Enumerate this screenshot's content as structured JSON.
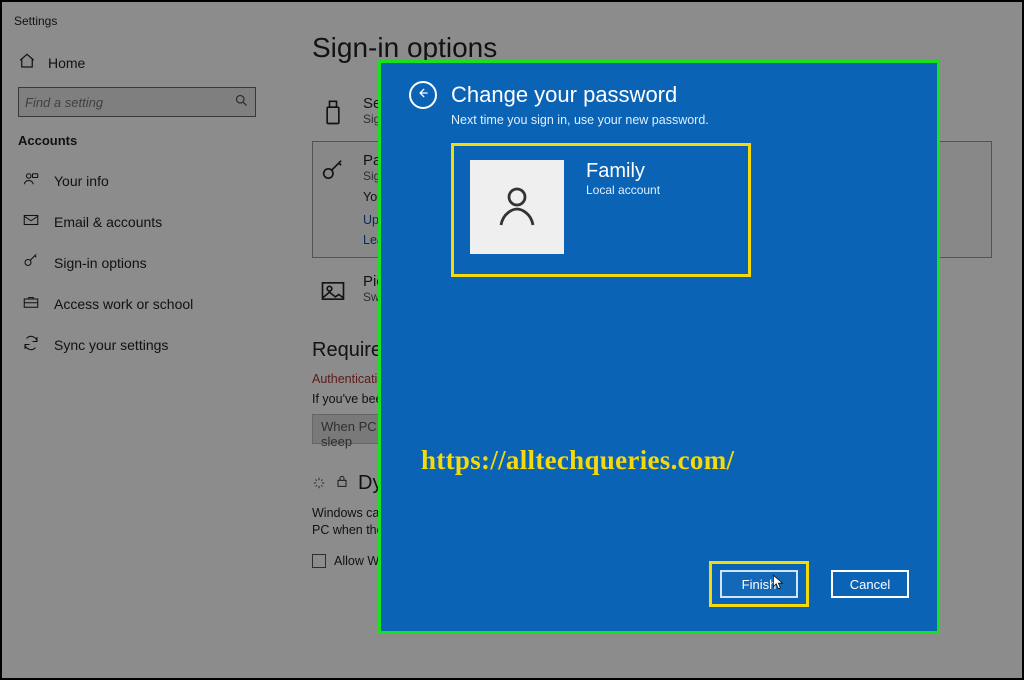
{
  "window_title": "Settings",
  "sidebar": {
    "home": "Home",
    "search_placeholder": "Find a setting",
    "section": "Accounts",
    "items": [
      {
        "label": "Your info"
      },
      {
        "label": "Email & accounts"
      },
      {
        "label": "Sign-in options"
      },
      {
        "label": "Access work or school"
      },
      {
        "label": "Sync your settings"
      }
    ]
  },
  "main": {
    "title": "Sign-in options",
    "options": {
      "security_key": {
        "title": "Security Key",
        "sub": "Sign in with a physical security key"
      },
      "password": {
        "title": "Password",
        "sub": "Sign in with your account's password",
        "body": "Your account password is used to sign in to Windows, apps, and services.",
        "link1": "Update your security questions",
        "link2": "Learn more"
      },
      "picture": {
        "title": "Picture Password",
        "sub": "Swipe and tap your favorite photo to unlock your device"
      }
    },
    "require": {
      "heading": "Require sign-in",
      "auth_warning": "Authentication is required when this device wakes from sleep.",
      "body": "If you've been away, when should Windows require you to sign in again?",
      "select_value": "When PC wakes up from sleep"
    },
    "dynamic": {
      "heading": "Dynamic lock",
      "body": "Windows can use devices that are paired to your PC to know when you're away and lock your PC when those devices go out of range.",
      "checkbox": "Allow Windows to automatically lock your device when you're away"
    }
  },
  "modal": {
    "title": "Change your password",
    "sub": "Next time you sign in, use your new password.",
    "user_name": "Family",
    "user_type": "Local account",
    "finish": "Finish",
    "cancel": "Cancel"
  },
  "watermark": "https://alltechqueries.com/"
}
